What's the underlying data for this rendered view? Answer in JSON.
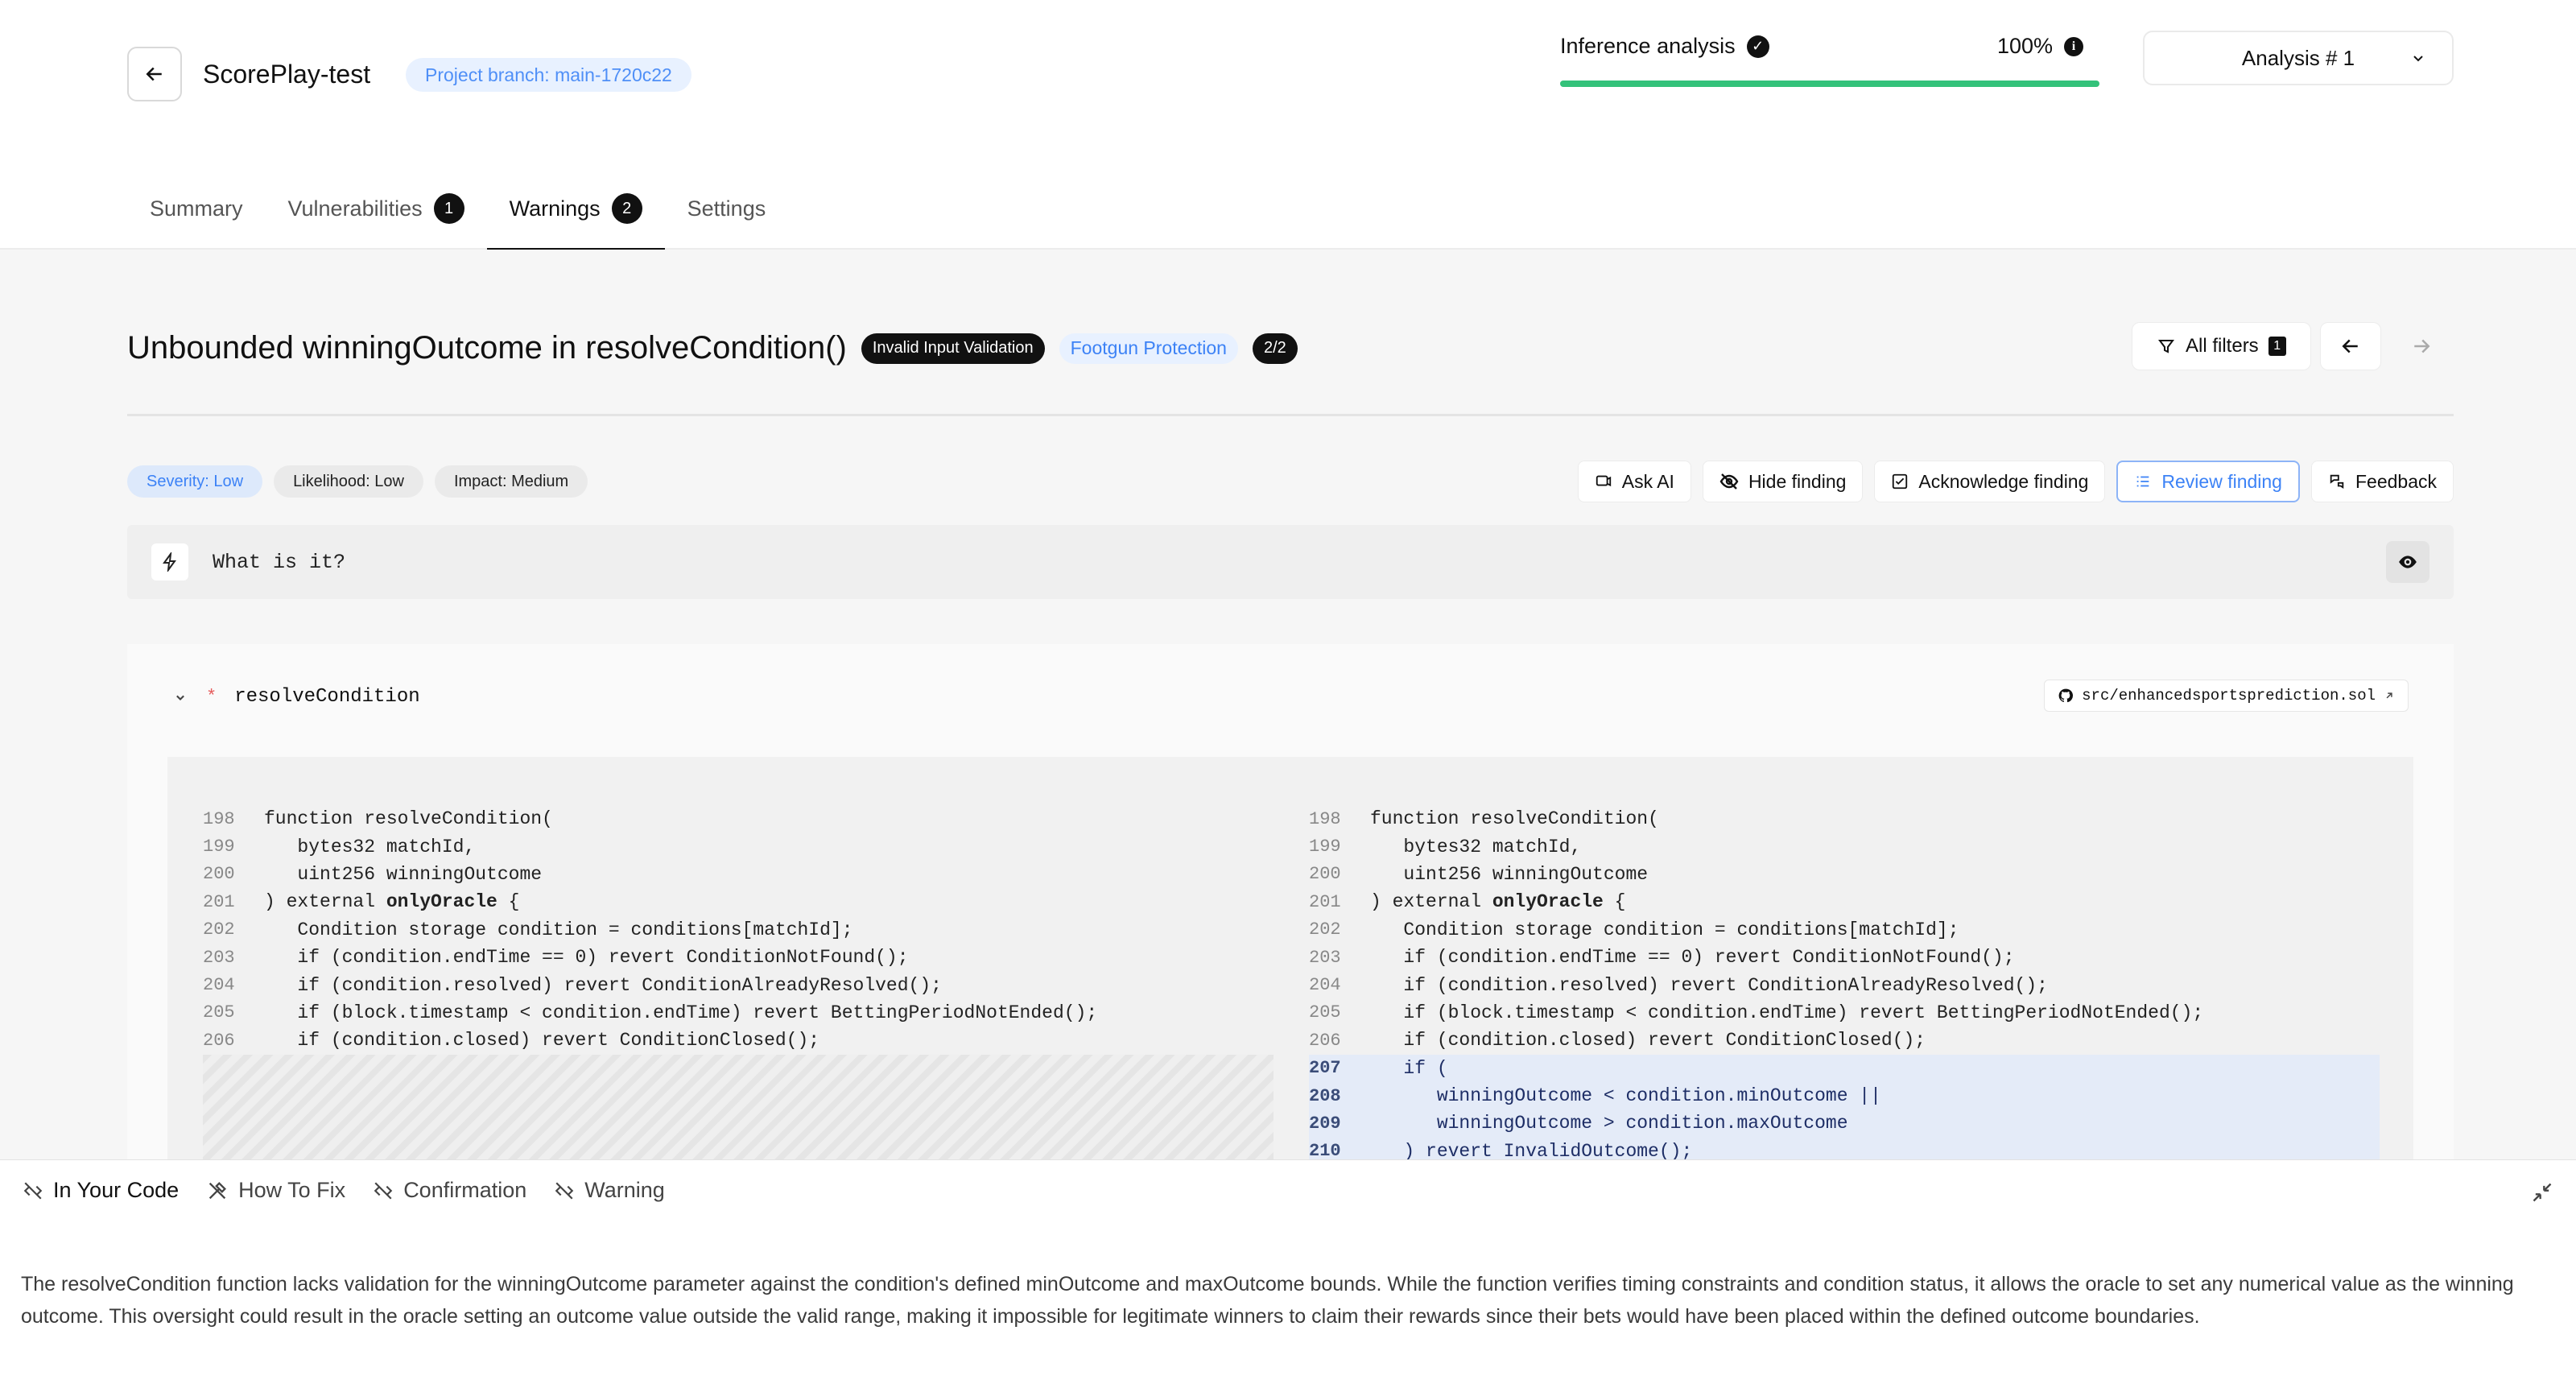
{
  "header": {
    "project_title": "ScorePlay-test",
    "branch": "Project branch: main-1720c22",
    "inference_label": "Inference analysis",
    "inference_percent": "100%",
    "inference_progress": 1.0,
    "analysis_select": "Analysis # 1"
  },
  "tabs": [
    {
      "label": "Summary",
      "badge": ""
    },
    {
      "label": "Vulnerabilities",
      "badge": "1"
    },
    {
      "label": "Warnings",
      "badge": "2"
    },
    {
      "label": "Settings",
      "badge": ""
    }
  ],
  "finding": {
    "title": "Unbounded winningOutcome in resolveCondition()",
    "tag_category": "Invalid Input Validation",
    "tag_group": "Footgun Protection",
    "tag_count": "2/2",
    "filters_label": "All filters",
    "filters_count": "1",
    "pills": {
      "severity": "Severity: Low",
      "likelihood": "Likelihood: Low",
      "impact": "Impact: Medium"
    },
    "actions": {
      "ask_ai": "Ask AI",
      "hide": "Hide finding",
      "acknowledge": "Acknowledge finding",
      "review": "Review finding",
      "feedback": "Feedback"
    },
    "what_is_it": "What is it?"
  },
  "code": {
    "function_name": "resolveCondition",
    "file_path": "src/enhancedsportsprediction.sol",
    "left_lines": [
      {
        "n": "198",
        "text": "function resolveCondition("
      },
      {
        "n": "199",
        "text": "   bytes32 matchId,"
      },
      {
        "n": "200",
        "text": "   uint256 winningOutcome"
      },
      {
        "n": "201",
        "text": ") external onlyOracle {"
      },
      {
        "n": "202",
        "text": "   Condition storage condition = conditions[matchId];"
      },
      {
        "n": "203",
        "text": "   if (condition.endTime == 0) revert ConditionNotFound();"
      },
      {
        "n": "204",
        "text": "   if (condition.resolved) revert ConditionAlreadyResolved();"
      },
      {
        "n": "205",
        "text": "   if (block.timestamp < condition.endTime) revert BettingPeriodNotEnded();"
      },
      {
        "n": "206",
        "text": "   if (condition.closed) revert ConditionClosed();"
      }
    ],
    "right_lines": [
      {
        "n": "198",
        "text": "function resolveCondition(",
        "hl": false
      },
      {
        "n": "199",
        "text": "   bytes32 matchId,",
        "hl": false
      },
      {
        "n": "200",
        "text": "   uint256 winningOutcome",
        "hl": false
      },
      {
        "n": "201",
        "text": ") external onlyOracle {",
        "hl": false
      },
      {
        "n": "202",
        "text": "   Condition storage condition = conditions[matchId];",
        "hl": false
      },
      {
        "n": "203",
        "text": "   if (condition.endTime == 0) revert ConditionNotFound();",
        "hl": false
      },
      {
        "n": "204",
        "text": "   if (condition.resolved) revert ConditionAlreadyResolved();",
        "hl": false
      },
      {
        "n": "205",
        "text": "   if (block.timestamp < condition.endTime) revert BettingPeriodNotEnded();",
        "hl": false
      },
      {
        "n": "206",
        "text": "   if (condition.closed) revert ConditionClosed();",
        "hl": false
      },
      {
        "n": "207",
        "text": "   if (",
        "hl": true
      },
      {
        "n": "208",
        "text": "      winningOutcome < condition.minOutcome ||",
        "hl": true
      },
      {
        "n": "209",
        "text": "      winningOutcome > condition.maxOutcome",
        "hl": true
      },
      {
        "n": "210",
        "text": "   ) revert InvalidOutcome();",
        "hl": true
      }
    ]
  },
  "bottom_panel": {
    "tabs": [
      "In Your Code",
      "How To Fix",
      "Confirmation",
      "Warning"
    ],
    "description": "The resolveCondition function lacks validation for the winningOutcome parameter against the condition's defined minOutcome and maxOutcome bounds. While the function verifies timing constraints and condition status, it allows the oracle to set any numerical value as the winning outcome. This oversight could result in the oracle setting an outcome value outside the valid range, making it impossible for legitimate winners to claim their rewards since their bets would have been placed within the defined outcome boundaries."
  },
  "colors": {
    "accent_blue": "#3c82f6",
    "progress_green": "#34c27a",
    "highlight_row": "#e4ebf8"
  }
}
